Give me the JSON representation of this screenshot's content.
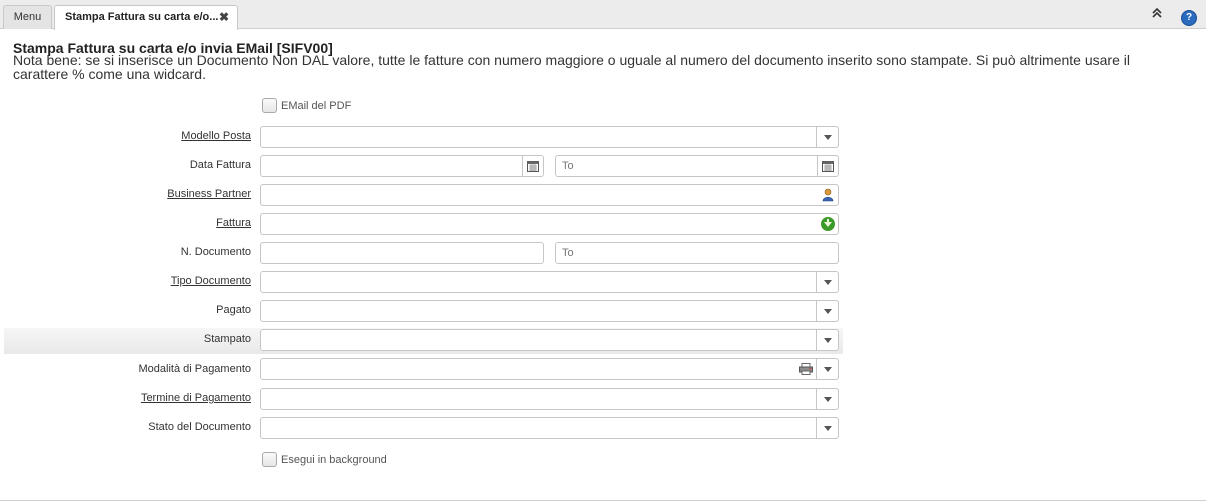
{
  "tabs": {
    "menu_label": "Menu",
    "active_label": "Stampa Fattura su carta e/o...",
    "close_glyph": "✖"
  },
  "header": {
    "collapse_glyph": "⌃",
    "help_glyph": "?"
  },
  "page": {
    "title": "Stampa Fattura su carta e/o invia EMail [SIFV00]",
    "note": "Nota bene: se si inserisce un Documento Non DAL valore, tutte le fatture con numero maggiore o uguale al numero del documento inserito sono stampate. Si può altrimente usare il carattere % come una widcard."
  },
  "form": {
    "email_pdf_label": "EMail del PDF",
    "modello_posta_label": "Modello Posta",
    "data_fattura_label": "Data Fattura",
    "data_fattura_to_placeholder": "To",
    "business_partner_label": "Business Partner",
    "fattura_label": "Fattura",
    "n_documento_label": "N. Documento",
    "n_documento_to_placeholder": "To",
    "tipo_documento_label": "Tipo Documento",
    "pagato_label": "Pagato",
    "stampato_label": "Stampato",
    "modalita_pagamento_label": "Modalità di Pagamento",
    "termine_pagamento_label": "Termine di Pagamento",
    "stato_documento_label": "Stato del Documento",
    "esegui_background_label": "Esegui in background"
  },
  "icons": {
    "calendar": "calendar-icon",
    "business_partner": "person-icon",
    "fattura": "green-arrow-icon",
    "payment": "printer-icon",
    "dropdown": "chevron-down-icon"
  }
}
